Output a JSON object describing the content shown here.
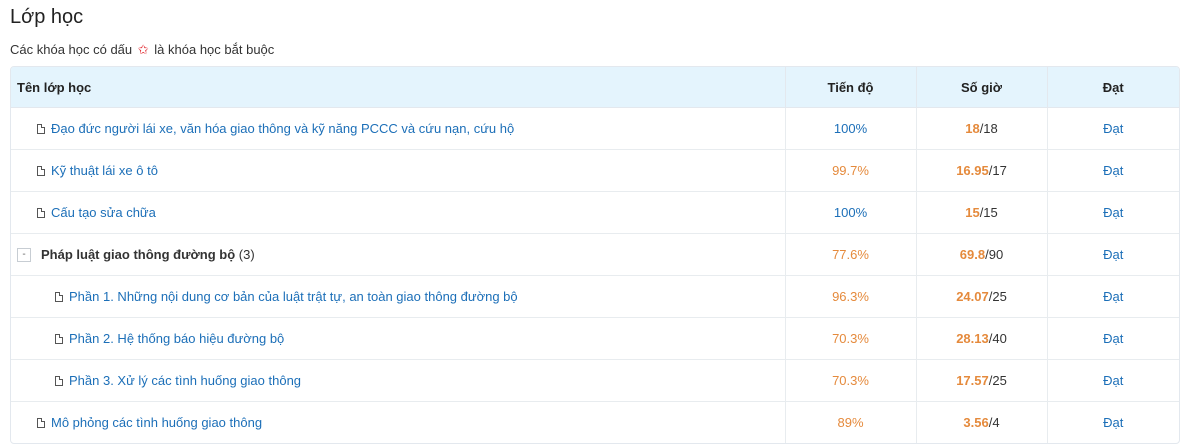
{
  "page": {
    "title": "Lớp học",
    "note_before": "Các khóa học có dấu",
    "note_star": "✩",
    "note_after": "là khóa học bắt buộc"
  },
  "table": {
    "headers": {
      "name": "Tên lớp học",
      "progress": "Tiến độ",
      "hours": "Số giờ",
      "result": "Đạt"
    },
    "rows": [
      {
        "name": "Đạo đức người lái xe, văn hóa giao thông và kỹ năng PCCC và cứu nạn, cứu hộ",
        "progress": "100%",
        "hours_done": "18",
        "hours_total": "/18",
        "result": "Đạt"
      },
      {
        "name": "Kỹ thuật lái xe ô tô",
        "progress": "99.7%",
        "hours_done": "16.95",
        "hours_total": "/17",
        "result": "Đạt"
      },
      {
        "name": "Cấu tạo sửa chữa",
        "progress": "100%",
        "hours_done": "15",
        "hours_total": "/15",
        "result": "Đạt"
      },
      {
        "name": "Pháp luật giao thông đường bộ",
        "count": "(3)",
        "collapse": "-",
        "progress": "77.6%",
        "hours_done": "69.8",
        "hours_total": "/90",
        "result": "Đạt"
      },
      {
        "name": "Phần 1. Những nội dung cơ bản của luật trật tự, an toàn giao thông đường bộ",
        "progress": "96.3%",
        "hours_done": "24.07",
        "hours_total": "/25",
        "result": "Đạt"
      },
      {
        "name": "Phần 2. Hệ thống báo hiệu đường bộ",
        "progress": "70.3%",
        "hours_done": "28.13",
        "hours_total": "/40",
        "result": "Đạt"
      },
      {
        "name": "Phần 3. Xử lý các tình huống giao thông",
        "progress": "70.3%",
        "hours_done": "17.57",
        "hours_total": "/25",
        "result": "Đạt"
      },
      {
        "name": "Mô phỏng các tình huống giao thông",
        "progress": "89%",
        "hours_done": "3.56",
        "hours_total": "/4",
        "result": "Đạt"
      }
    ]
  },
  "colors": {
    "link_blue": "#1c6fb8",
    "orange": "#e58a3c",
    "header_bg": "#e4f4fd",
    "star_red": "#e0242b"
  },
  "icons": {
    "course": "document-icon",
    "group_toggle": "collapse-minus-icon",
    "required_marker": "star-icon"
  }
}
